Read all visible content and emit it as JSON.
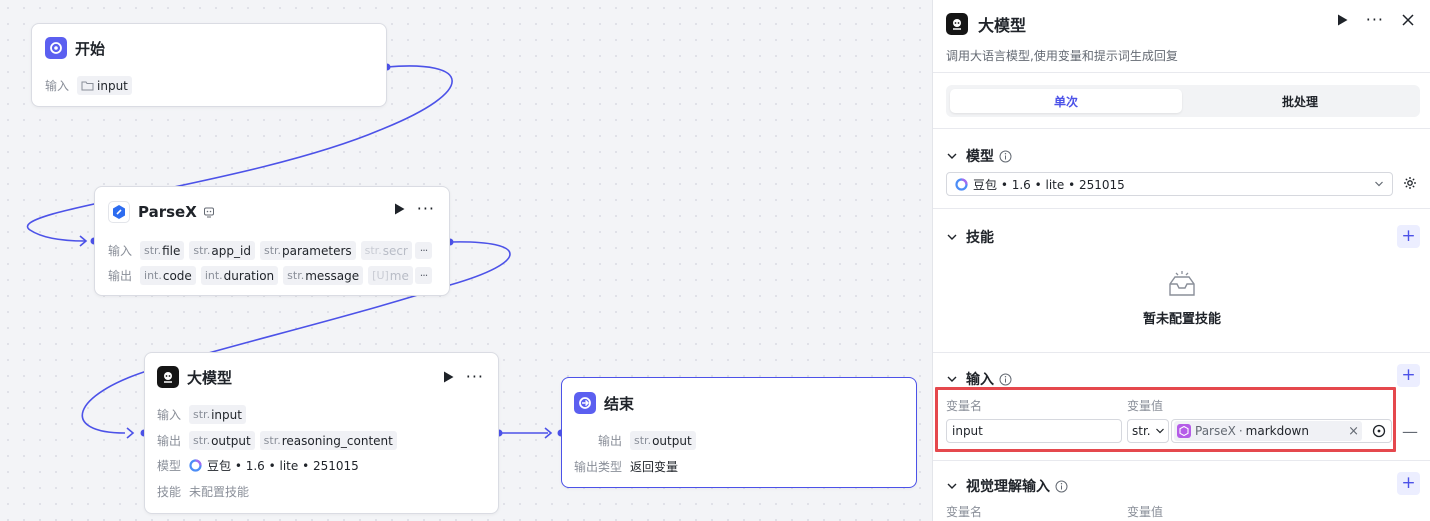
{
  "canvas": {
    "start_node": {
      "title": "开始",
      "input_label": "输入",
      "input_tag": "input"
    },
    "parsex_node": {
      "title": "ParseX",
      "input_label": "输入",
      "inputs": [
        {
          "type": "str.",
          "name": "file"
        },
        {
          "type": "str.",
          "name": "app_id"
        },
        {
          "type": "str.",
          "name": "parameters"
        },
        {
          "type": "str.",
          "name": "secr"
        }
      ],
      "output_label": "输出",
      "outputs": [
        {
          "type": "int.",
          "name": "code"
        },
        {
          "type": "int.",
          "name": "duration"
        },
        {
          "type": "str.",
          "name": "message"
        },
        {
          "type": "[U]",
          "name": "me"
        }
      ],
      "more": "···"
    },
    "llm_node": {
      "title": "大模型",
      "input_label": "输入",
      "inputs": [
        {
          "type": "str.",
          "name": "input"
        }
      ],
      "output_label": "输出",
      "outputs": [
        {
          "type": "str.",
          "name": "output"
        },
        {
          "type": "str.",
          "name": "reasoning_content"
        }
      ],
      "model_label": "模型",
      "model_value": "豆包 • 1.6 • lite • 251015",
      "skill_label": "技能",
      "skill_value": "未配置技能"
    },
    "end_node": {
      "title": "结束",
      "output_label": "输出",
      "output": {
        "type": "str.",
        "name": "output"
      },
      "output_type_label": "输出类型",
      "output_type_value": "返回变量"
    }
  },
  "panel": {
    "title": "大模型",
    "description": "调用大语言模型,使用变量和提示词生成回复",
    "tabs": {
      "single": "单次",
      "batch": "批处理"
    },
    "model_section": {
      "title": "模型",
      "value": "豆包 • 1.6 • lite • 251015"
    },
    "skills_section": {
      "title": "技能",
      "empty_text": "暂未配置技能"
    },
    "input_section": {
      "title": "输入",
      "col_name": "变量名",
      "col_value": "变量值",
      "row": {
        "name": "input",
        "type": "str.",
        "source": "ParseX",
        "separator": "·",
        "field": "markdown",
        "clear": "×"
      }
    },
    "vision_section": {
      "title": "视觉理解输入",
      "col_name": "变量名",
      "col_value": "变量值"
    }
  },
  "colors": {
    "accent": "#4c52e8",
    "highlight": "#e5484d",
    "edge": "#4c52e8"
  }
}
